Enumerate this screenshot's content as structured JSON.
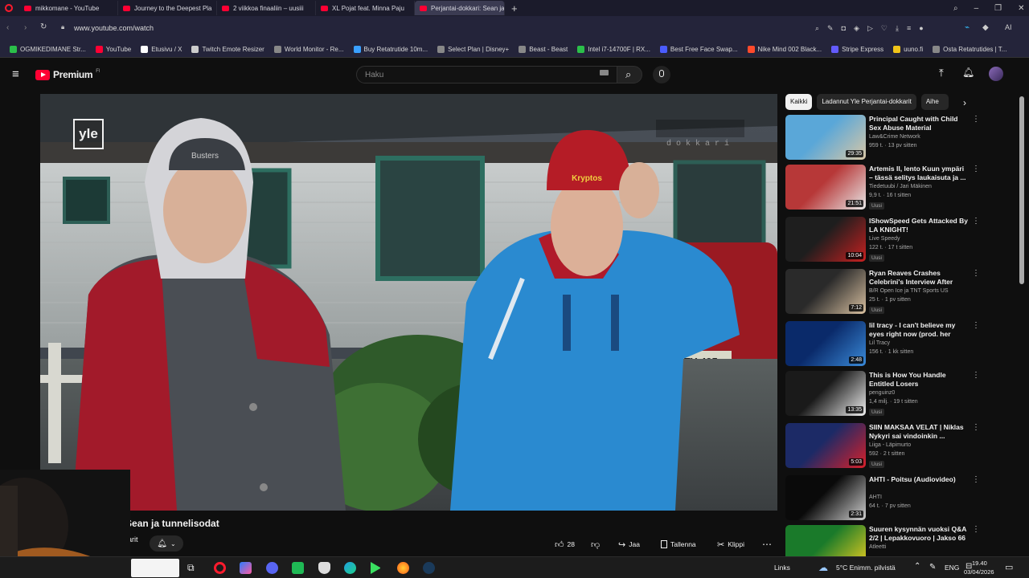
{
  "browser": {
    "tabs": [
      {
        "title": "mikkomane - YouTube",
        "active": false
      },
      {
        "title": "Journey to the Deepest Pla",
        "active": false
      },
      {
        "title": "2 viikkoa finaaliin – uusiii",
        "active": false
      },
      {
        "title": "XL Pojat feat. Minna Paju",
        "active": false
      },
      {
        "title": "Perjantai-dokkari: Sean ja",
        "active": true
      }
    ],
    "url": "www.youtube.com/watch",
    "ai_label": "AI",
    "bookmarks": [
      {
        "label": "OGMIKEDIMANE Str...",
        "color": "#2bbf4a"
      },
      {
        "label": "YouTube",
        "color": "#ff0033"
      },
      {
        "label": "Etusivu / X",
        "color": "#ffffff"
      },
      {
        "label": "Twitch Emote Resizer",
        "color": "#cccccc"
      },
      {
        "label": "World Monitor - Re...",
        "color": "#888888"
      },
      {
        "label": "Buy Retatrutide 10m...",
        "color": "#3aa0ff"
      },
      {
        "label": "Select Plan | Disney+",
        "color": "#888888"
      },
      {
        "label": "Beast - Beast",
        "color": "#888888"
      },
      {
        "label": "Intel i7-14700F | RX...",
        "color": "#2bbf4a"
      },
      {
        "label": "Best Free Face Swap...",
        "color": "#4a5cff"
      },
      {
        "label": "Nike Mind 002 Black...",
        "color": "#ff4a2b"
      },
      {
        "label": "Stripe Express",
        "color": "#635bff"
      },
      {
        "label": "uuno.fi",
        "color": "#f0c419"
      },
      {
        "label": "Osta Retatrutides | T...",
        "color": "#888888"
      }
    ]
  },
  "youtube": {
    "logo_label": "Premium",
    "logo_sup": "FI",
    "search_placeholder": "Haku",
    "video": {
      "broadcaster_logo": "yle",
      "watermark": "dokkari",
      "plate": "ITY-495",
      "cap_text": "Kryptos",
      "hood_text": "Busters"
    },
    "title": "dokkari: Sean ja tunnelisodat",
    "channel": "dokkarit",
    "actions": {
      "likes": "28",
      "share": "Jaa",
      "save": "Tallenna",
      "clip": "Klippi"
    },
    "chips": [
      {
        "label": "Kaikki",
        "active": true
      },
      {
        "label": "Ladannut Yle Perjantai-dokkarit",
        "active": false
      },
      {
        "label": "Aihe",
        "active": false
      }
    ],
    "recommendations": [
      {
        "title": "Principal Caught with Child Sex Abuse Material",
        "channel": "Law&Crime Network",
        "meta": "959 t. · 13 pv sitten",
        "duration": "29:35",
        "new": "",
        "thumb": [
          "#5aa7d8",
          "#d9c7a6"
        ]
      },
      {
        "title": "Artemis II, lento Kuun ympäri – tässä selitys laukaisuta ja ...",
        "channel": "Tiedetuubi / Jari Mäkinen",
        "meta": "9,9 t. · 16 t sitten",
        "duration": "21:51",
        "new": "Uusi",
        "thumb": [
          "#b73838",
          "#e8e8e8"
        ]
      },
      {
        "title": "IShowSpeed Gets Attacked By LA KNIGHT!",
        "channel": "Live Speedy",
        "meta": "122 t. · 17 t sitten",
        "duration": "10:04",
        "new": "Uusi",
        "thumb": [
          "#1e1e1e",
          "#c82020"
        ]
      },
      {
        "title": "Ryan Reaves Crashes Celebrini's Interview After His...",
        "channel": "B/R Open Ice ja TNT Sports US",
        "meta": "25 t. · 1 pv sitten",
        "duration": "7:12",
        "new": "Uusi",
        "thumb": [
          "#2a2a2a",
          "#d8c0a0"
        ]
      },
      {
        "title": "lil tracy - I can't believe my eyes right now (prod. her blood)",
        "channel": "Lil Tracy",
        "meta": "156 t. · 1 kk sitten",
        "duration": "2:48",
        "new": "",
        "thumb": [
          "#0a2a6a",
          "#3a8ad8"
        ]
      },
      {
        "title": "This is How You Handle Entitled Losers",
        "channel": "penguinz0",
        "meta": "1,4 milj. · 19 t sitten",
        "duration": "13:35",
        "new": "Uusi",
        "thumb": [
          "#1a1a1a",
          "#f0f0f0"
        ]
      },
      {
        "title": "SIIN MAKSAA VELAT | Niklas Nykyri sai vindoinkin ...",
        "channel": "Liiga - Läpimurto",
        "meta": "592 · 2 t sitten",
        "duration": "5:03",
        "new": "Uusi",
        "thumb": [
          "#1c2a66",
          "#d8202a"
        ]
      },
      {
        "title": "AHTI - Poitsu (Audiovideo)",
        "channel": "AHTI",
        "meta": "64 t. · 7 pv sitten",
        "duration": "2:31",
        "new": "",
        "thumb": [
          "#0a0a0a",
          "#d0d0d0"
        ]
      },
      {
        "title": "Suuren kysynnän vuoksi Q&A 2/2 | Lepakkovuoro | Jakso 66",
        "channel": "Atleetti",
        "meta": "",
        "duration": "",
        "new": "",
        "thumb": [
          "#1a7a2a",
          "#f0d020"
        ]
      }
    ]
  },
  "taskbar": {
    "links": "Links",
    "weather": "5°C Enimm. pilvistä",
    "lang": "ENG",
    "time": "19.40",
    "date": "03/04/2026"
  }
}
